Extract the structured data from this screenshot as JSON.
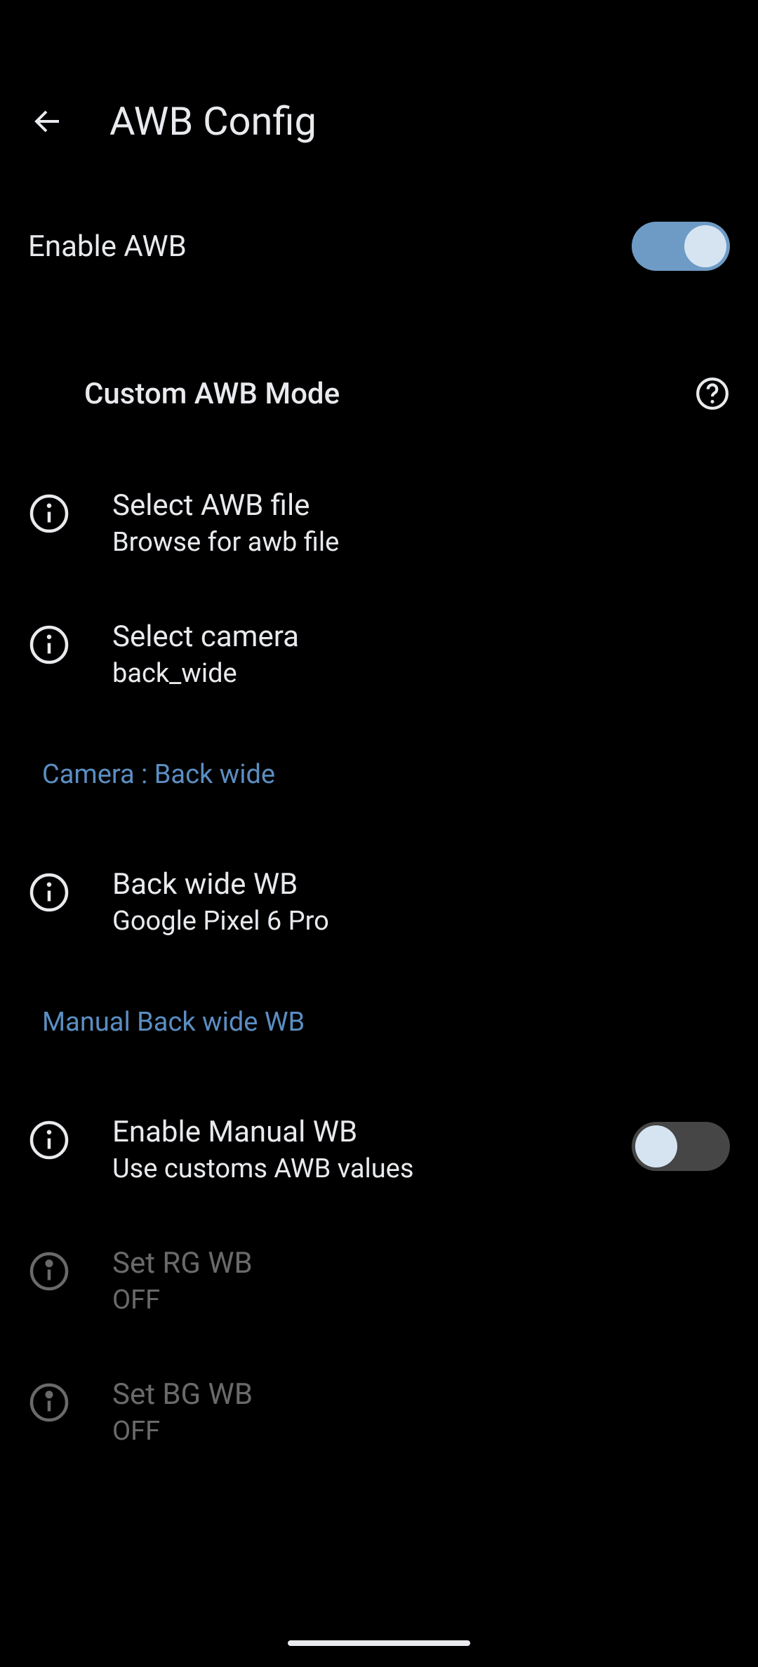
{
  "header": {
    "title": "AWB Config"
  },
  "enable": {
    "label": "Enable AWB",
    "on": true
  },
  "custom_mode": {
    "heading": "Custom AWB Mode"
  },
  "select_file": {
    "title": "Select AWB file",
    "sub": "Browse for awb file"
  },
  "select_camera": {
    "title": "Select camera",
    "sub": "back_wide"
  },
  "camera_section": {
    "heading": "Camera : Back wide"
  },
  "back_wide_wb": {
    "title": "Back wide WB",
    "sub": "Google Pixel 6 Pro"
  },
  "manual_section": {
    "heading": "Manual Back wide WB"
  },
  "enable_manual": {
    "title": "Enable Manual WB",
    "sub": "Use customs AWB values",
    "on": false
  },
  "set_rg": {
    "title": "Set RG WB",
    "sub": "OFF"
  },
  "set_bg": {
    "title": "Set BG WB",
    "sub": "OFF"
  }
}
